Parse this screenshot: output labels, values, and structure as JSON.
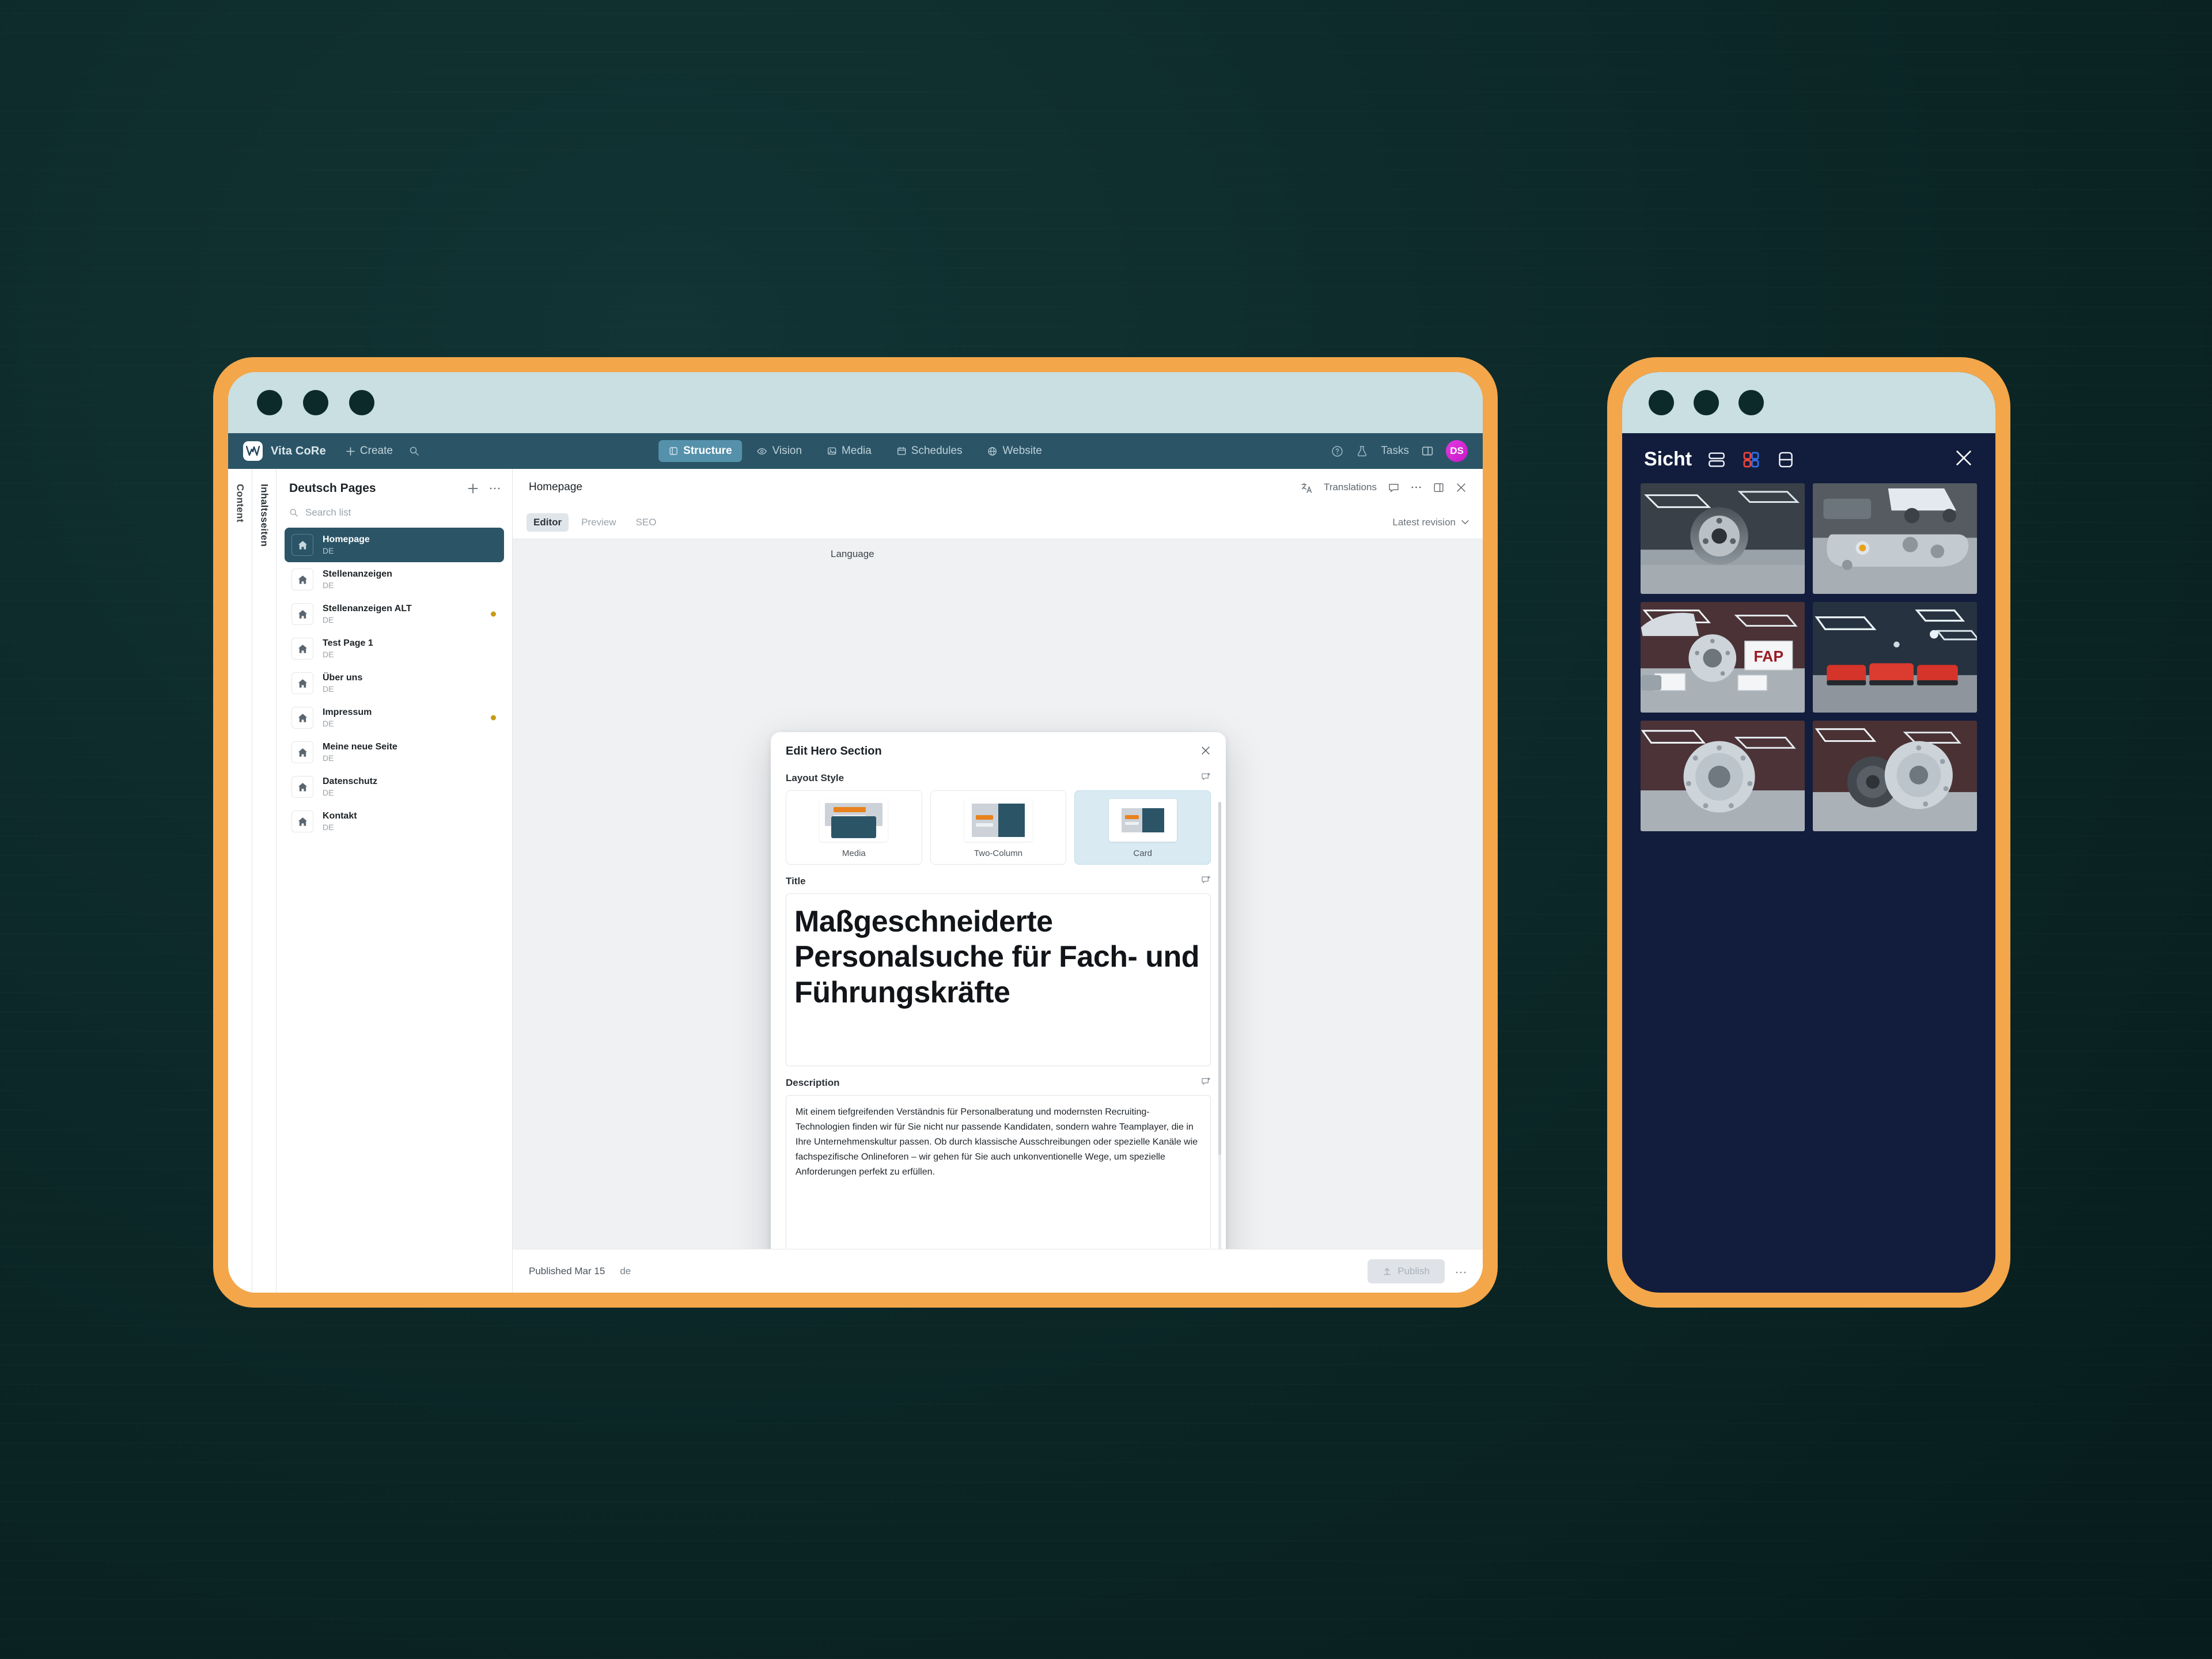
{
  "app": {
    "brand": "Vita CoRe",
    "create_label": "Create",
    "nav_tabs": [
      {
        "label": "Structure",
        "icon": "structure-icon",
        "active": true
      },
      {
        "label": "Vision",
        "icon": "eye-icon",
        "active": false
      },
      {
        "label": "Media",
        "icon": "image-icon",
        "active": false
      },
      {
        "label": "Schedules",
        "icon": "calendar-icon",
        "active": false
      },
      {
        "label": "Website",
        "icon": "globe-icon",
        "active": false
      }
    ],
    "tasks_label": "Tasks",
    "avatar_initials": "DS",
    "avatar_color": "#d92ed9",
    "accent_color": "#2b5567",
    "active_tab_color": "#5591ab"
  },
  "rails": {
    "rail_one": "Content",
    "rail_two": "Inhaltsseiten"
  },
  "pagelist": {
    "title": "Deutsch Pages",
    "search_placeholder": "Search list",
    "items": [
      {
        "name": "Homepage",
        "lang": "DE",
        "selected": true,
        "dot": false
      },
      {
        "name": "Stellenanzeigen",
        "lang": "DE",
        "selected": false,
        "dot": false
      },
      {
        "name": "Stellenanzeigen ALT",
        "lang": "DE",
        "selected": false,
        "dot": true
      },
      {
        "name": "Test Page 1",
        "lang": "DE",
        "selected": false,
        "dot": false
      },
      {
        "name": "Über uns",
        "lang": "DE",
        "selected": false,
        "dot": false
      },
      {
        "name": "Impressum",
        "lang": "DE",
        "selected": false,
        "dot": true
      },
      {
        "name": "Meine neue Seite",
        "lang": "DE",
        "selected": false,
        "dot": false
      },
      {
        "name": "Datenschutz",
        "lang": "DE",
        "selected": false,
        "dot": false
      },
      {
        "name": "Kontakt",
        "lang": "DE",
        "selected": false,
        "dot": false
      }
    ]
  },
  "editor": {
    "title": "Homepage",
    "translations_label": "Translations",
    "tabs": [
      {
        "label": "Editor",
        "active": true
      },
      {
        "label": "Preview",
        "active": false
      },
      {
        "label": "SEO",
        "active": false
      }
    ],
    "revision_label": "Latest revision",
    "ghost_field_label": "Language",
    "footer": {
      "status": "Published Mar 15",
      "lang": "de",
      "publish_label": "Publish"
    }
  },
  "modal": {
    "title": "Edit Hero Section",
    "layout_label": "Layout Style",
    "layout_options": [
      {
        "label": "Media",
        "selected": false
      },
      {
        "label": "Two-Column",
        "selected": false
      },
      {
        "label": "Card",
        "selected": true
      }
    ],
    "title_label": "Title",
    "title_value": "Maßgeschneiderte Personalsuche für Fach- und Führungskräfte",
    "description_label": "Description",
    "description_value": "Mit einem tiefgreifenden Verständnis für Personalberatung und modernsten Recruiting-Technologien finden wir für Sie nicht nur passende Kandidaten, sondern wahre Teamplayer, die in Ihre Unternehmenskultur passen. Ob durch klassische Ausschreibungen oder spezielle Kanäle wie fachspezifische Onlineforen – wir gehen für Sie auch unkonventionelle Wege, um spezielle Anforderungen perfekt zu erfüllen."
  },
  "phone": {
    "brand": "Sicht",
    "view_modes": [
      {
        "name": "list-view-icon",
        "active": false
      },
      {
        "name": "grid-view-icon",
        "active": true
      },
      {
        "name": "single-view-icon",
        "active": false
      }
    ],
    "background_color": "#121d3d",
    "photos": [
      {
        "alt": "brake drum in workshop"
      },
      {
        "alt": "brake caliper with car in background"
      },
      {
        "alt": "FAP brake kit product display"
      },
      {
        "alt": "red brake pads on gravel"
      },
      {
        "alt": "drilled brake rotor"
      },
      {
        "alt": "pair of brake rotors"
      }
    ]
  },
  "device": {
    "frame_color": "#f3a64a",
    "titlebar_color": "#c9dfe2"
  }
}
